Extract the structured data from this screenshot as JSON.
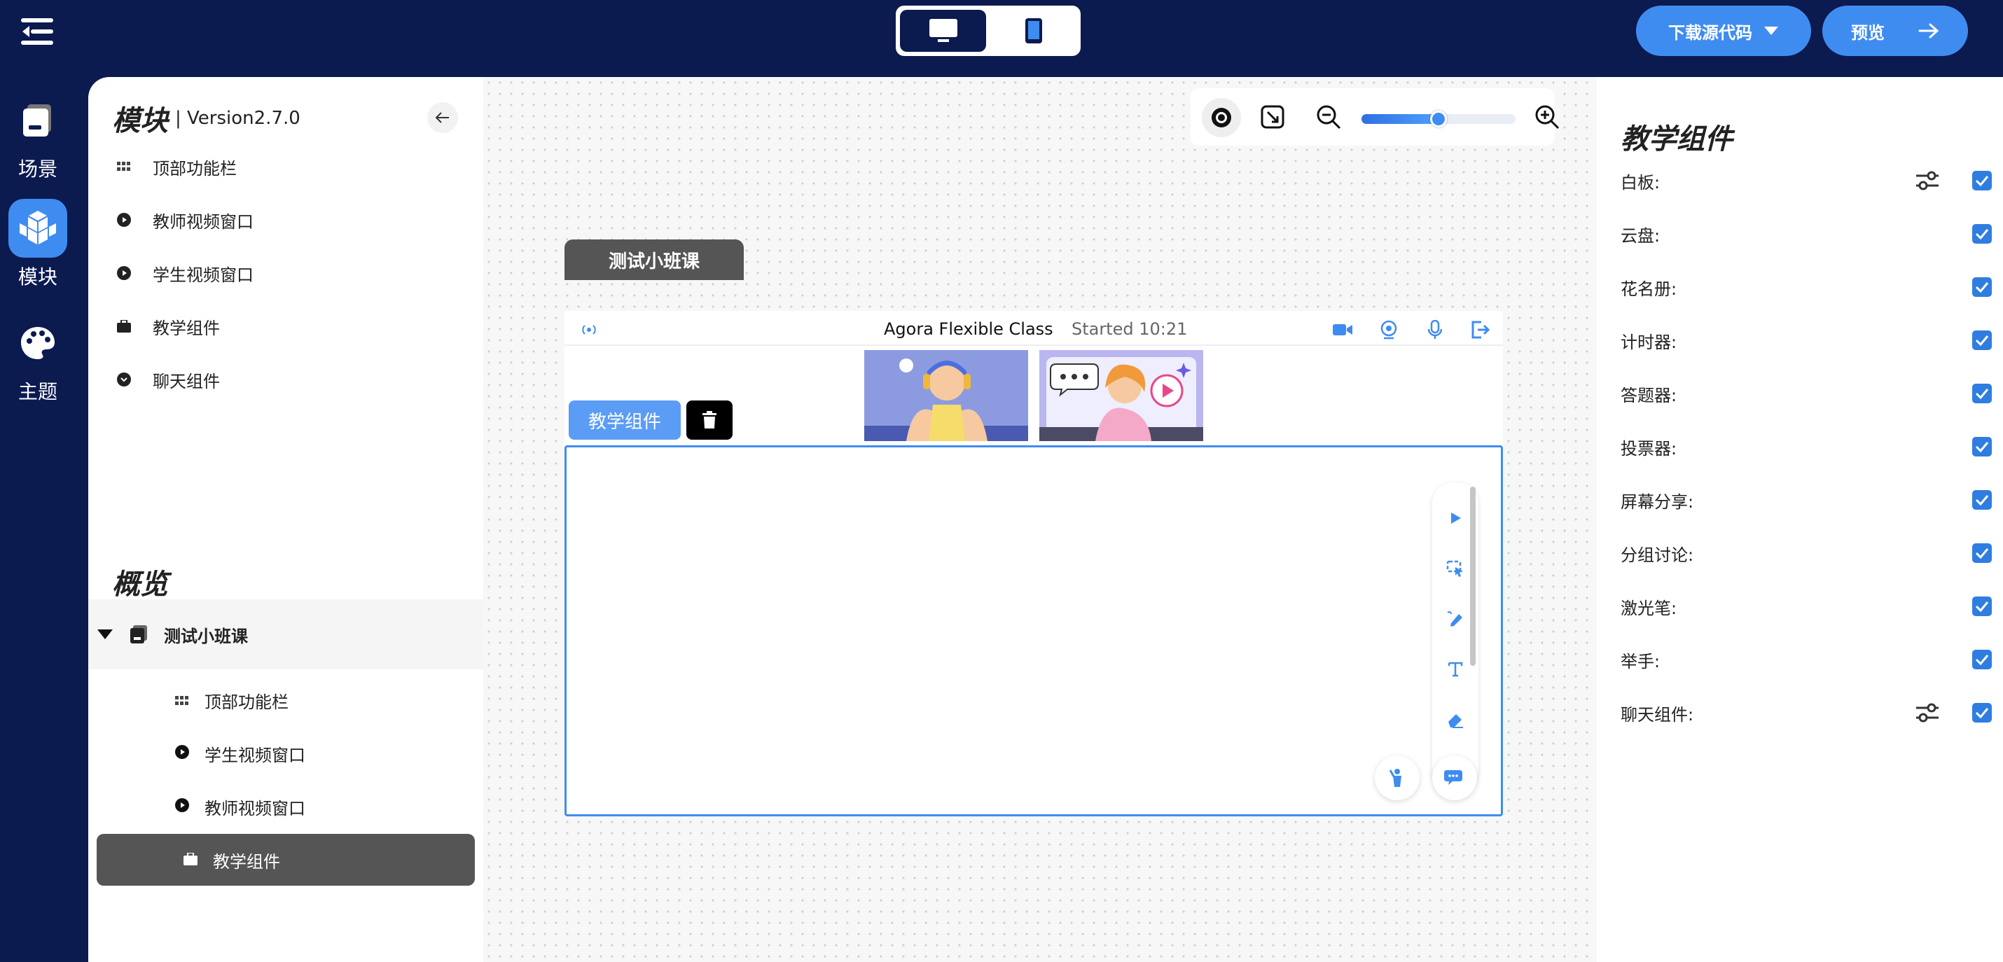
{
  "topbar": {
    "download_label": "下载源代码",
    "preview_label": "预览"
  },
  "rail": {
    "items": [
      {
        "label": "场景"
      },
      {
        "label": "模块"
      },
      {
        "label": "主题"
      }
    ]
  },
  "module_panel": {
    "title": "模块",
    "version": "Version2.7.0",
    "items": [
      {
        "label": "顶部功能栏"
      },
      {
        "label": "教师视频窗口"
      },
      {
        "label": "学生视频窗口"
      },
      {
        "label": "教学组件"
      },
      {
        "label": "聊天组件"
      }
    ]
  },
  "overview": {
    "title": "概览",
    "root_label": "测试小班课",
    "children": [
      {
        "label": "顶部功能栏"
      },
      {
        "label": "学生视频窗口"
      },
      {
        "label": "教师视频窗口"
      },
      {
        "label": "教学组件"
      }
    ]
  },
  "canvas": {
    "scene_tab": "测试小班课",
    "class_name": "Agora Flexible Class",
    "class_time": "Started 10:21",
    "selected_label": "教学组件",
    "zoom_fraction": 0.5
  },
  "right_panel": {
    "title": "教学组件",
    "options": [
      {
        "label": "白板:",
        "checked": true
      },
      {
        "label": "云盘:",
        "checked": true
      },
      {
        "label": "花名册:",
        "checked": true
      },
      {
        "label": "计时器:",
        "checked": true
      },
      {
        "label": "答题器:",
        "checked": true
      },
      {
        "label": "投票器:",
        "checked": true
      },
      {
        "label": "屏幕分享:",
        "checked": true
      },
      {
        "label": "分组讨论:",
        "checked": true
      },
      {
        "label": "激光笔:",
        "checked": true
      },
      {
        "label": "举手:",
        "checked": true
      },
      {
        "label": "聊天组件:",
        "checked": true
      }
    ]
  },
  "colors": {
    "navy": "#0b1a4f",
    "accent": "#3f8cf1",
    "selected_bg": "#555555"
  }
}
